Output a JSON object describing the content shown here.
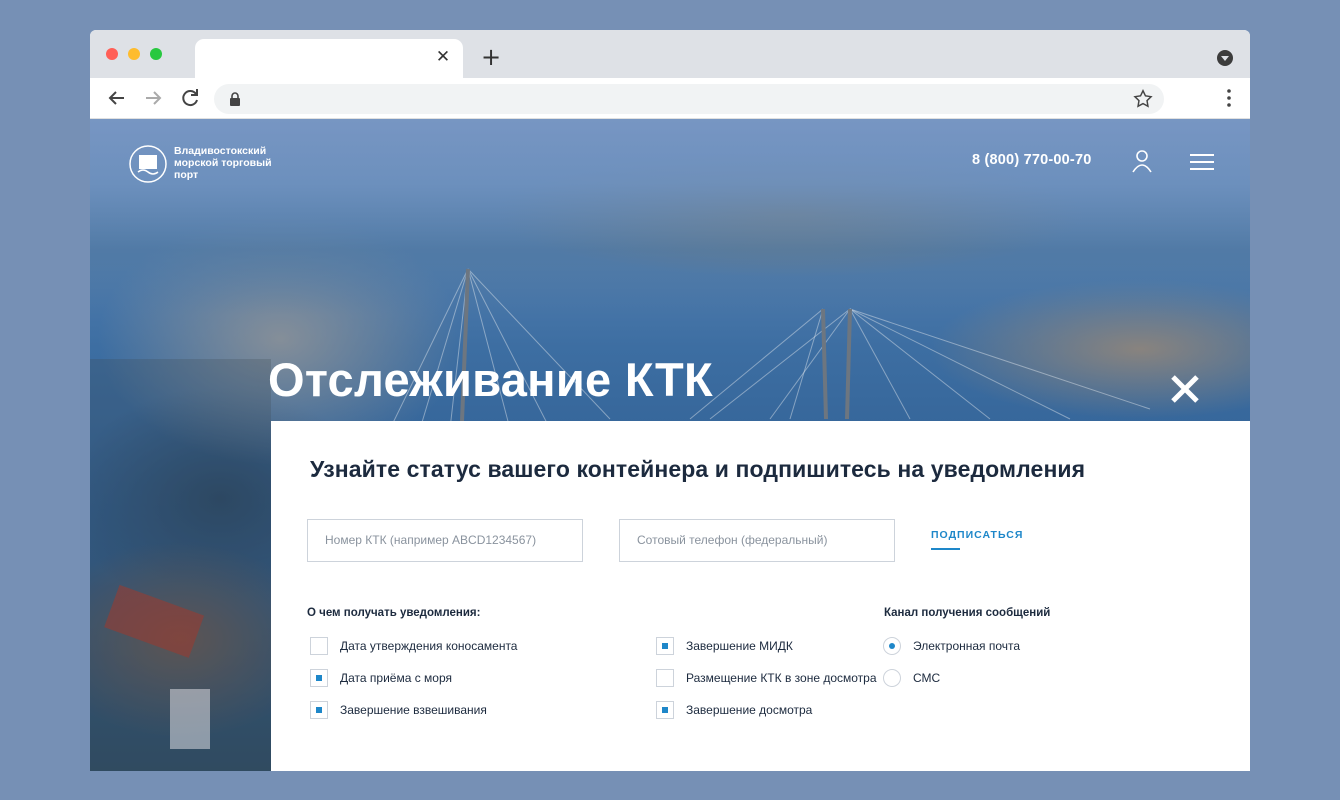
{
  "site": {
    "logo_text": "Владивостокский морской торговый порт",
    "phone": "8 (800) 770-00-70"
  },
  "hero": {
    "title": "Отслеживание КТК"
  },
  "panel": {
    "heading": "Узнайте статус вашего контейнера и подпишитесь на уведомления",
    "ktk_placeholder": "Номер КТК (например ABCD1234567)",
    "phone_placeholder": "Сотовый телефон (федеральный)",
    "subscribe_label": "ПОДПИСАТЬСЯ",
    "notify_label": "О чем получать уведомления:",
    "channel_label": "Канал получения сообщений",
    "options": [
      {
        "label": "Дата утверждения коносамента",
        "checked": false
      },
      {
        "label": "Дата приёма с моря",
        "checked": true
      },
      {
        "label": "Завершение взвешивания",
        "checked": true
      },
      {
        "label": "Завершение МИДК",
        "checked": true
      },
      {
        "label": "Размещение КТК в зоне досмотра",
        "checked": false
      },
      {
        "label": "Завершение досмотра",
        "checked": true
      }
    ],
    "channels": [
      {
        "label": "Электронная почта",
        "selected": true
      },
      {
        "label": "СМС",
        "selected": false
      }
    ]
  },
  "colors": {
    "accent": "#1e87c9",
    "text": "#1c2a3e",
    "background": "#7690b5"
  }
}
